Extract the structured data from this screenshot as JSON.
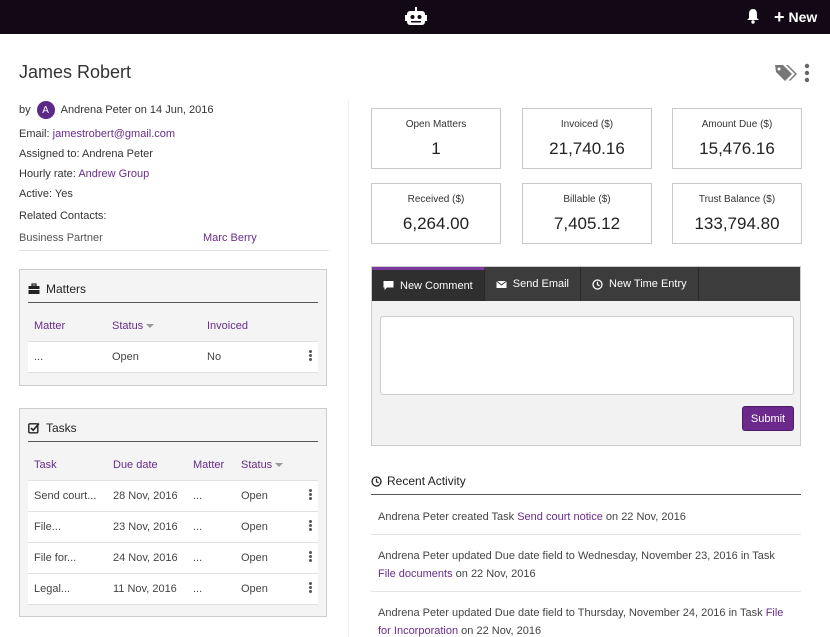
{
  "topbar": {
    "new_label": "New"
  },
  "contact": {
    "name": "James Robert",
    "by_prefix": "by",
    "avatar_letter": "A",
    "created_by_text": "Andrena Peter on 14 Jun, 2016",
    "email_label": "Email:",
    "email": "jamestrobert@gmail.com",
    "assigned_label": "Assigned to:",
    "assigned_to": "Andrena Peter",
    "rate_label": "Hourly rate:",
    "rate": "Andrew Group",
    "active_label": "Active:",
    "active": "Yes",
    "related_label": "Related Contacts:",
    "related": [
      {
        "role": "Business Partner",
        "name": "Marc Berry"
      }
    ]
  },
  "matters": {
    "title": "Matters",
    "columns": [
      "Matter",
      "Status",
      "Invoiced"
    ],
    "rows": [
      {
        "matter": "...",
        "status": "Open",
        "invoiced": "No"
      }
    ]
  },
  "tasks": {
    "title": "Tasks",
    "columns": [
      "Task",
      "Due date",
      "Matter",
      "Status"
    ],
    "rows": [
      {
        "task": "Send court...",
        "due": "28 Nov, 2016",
        "matter": "...",
        "status": "Open"
      },
      {
        "task": "File...",
        "due": "23 Nov, 2016",
        "matter": "...",
        "status": "Open"
      },
      {
        "task": "File for...",
        "due": "24 Nov, 2016",
        "matter": "...",
        "status": "Open"
      },
      {
        "task": "Legal...",
        "due": "11 Nov, 2016",
        "matter": "...",
        "status": "Open"
      }
    ]
  },
  "stats": [
    {
      "label": "Open Matters",
      "value": "1"
    },
    {
      "label": "Invoiced ($)",
      "value": "21,740.16"
    },
    {
      "label": "Amount Due ($)",
      "value": "15,476.16"
    },
    {
      "label": "Received ($)",
      "value": "6,264.00"
    },
    {
      "label": "Billable ($)",
      "value": "7,405.12"
    },
    {
      "label": "Trust Balance ($)",
      "value": "133,794.80"
    }
  ],
  "composer": {
    "tabs": [
      "New Comment",
      "Send Email",
      "New Time Entry"
    ],
    "submit_label": "Submit"
  },
  "activity": {
    "title": "Recent Activity",
    "items": [
      {
        "pre": "Andrena Peter created Task ",
        "link": "Send court notice",
        "post": " on 22 Nov, 2016"
      },
      {
        "pre": "Andrena Peter updated Due date field to Wednesday, November 23, 2016 in Task ",
        "link": "File documents",
        "post": " on 22 Nov, 2016"
      },
      {
        "pre": "Andrena Peter updated Due date field to Thursday, November 24, 2016 in Task ",
        "link": "File for Incorporation",
        "post": " on 22 Nov, 2016"
      }
    ]
  },
  "colors": {
    "topbar": "#120816",
    "accent": "#6a2c8c",
    "tab_bar": "#3c3c3c"
  }
}
